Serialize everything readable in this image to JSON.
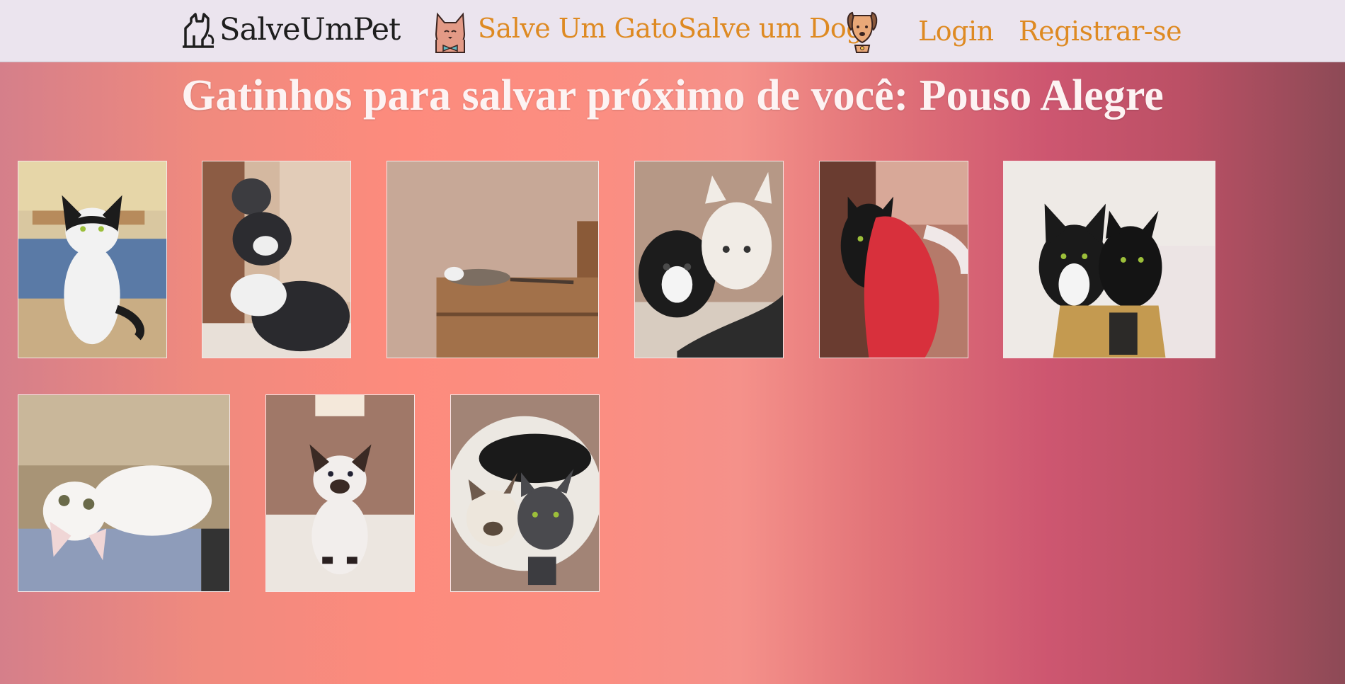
{
  "navbar": {
    "brand": "SalveUmPet",
    "links": {
      "cats": "Salve Um Gato",
      "dogs": "Salve um Dog",
      "login": "Login",
      "register": "Registrar-se"
    },
    "link_color": "#de8a22"
  },
  "main": {
    "title": "Gatinhos para salvar próximo de você: Pouso Alegre"
  },
  "gallery": {
    "photos": [
      {
        "subject": "black-and-white cat sitting on wooden table"
      },
      {
        "subject": "gray and tuxedo kittens in corner"
      },
      {
        "subject": "tabby kitten lying on wooden shelf"
      },
      {
        "subject": "tuxedo kitten and siamese kitten"
      },
      {
        "subject": "black cat held in red cloth"
      },
      {
        "subject": "tuxedo cat and black cat in cardboard box"
      },
      {
        "subject": "white cat lying upside down"
      },
      {
        "subject": "siamese kitten in cardboard box"
      },
      {
        "subject": "siamese and gray kittens in basket"
      }
    ]
  }
}
